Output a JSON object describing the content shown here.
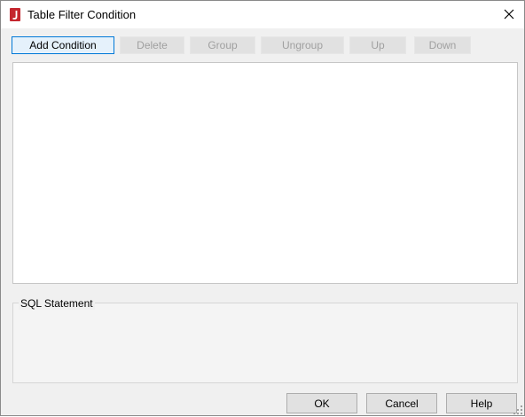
{
  "window": {
    "title": "Table Filter Condition",
    "app_icon": "jreport-j-icon",
    "close_icon": "close-icon"
  },
  "toolbar": {
    "add_condition": "Add Condition",
    "delete": "Delete",
    "group": "Group",
    "ungroup": "Ungroup",
    "up": "Up",
    "down": "Down"
  },
  "sql": {
    "legend": "SQL Statement"
  },
  "footer": {
    "ok": "OK",
    "cancel": "Cancel",
    "help": "Help"
  },
  "colors": {
    "accent": "#0078d7",
    "icon_red": "#c4262e",
    "disabled_text": "#a0a0a0"
  }
}
